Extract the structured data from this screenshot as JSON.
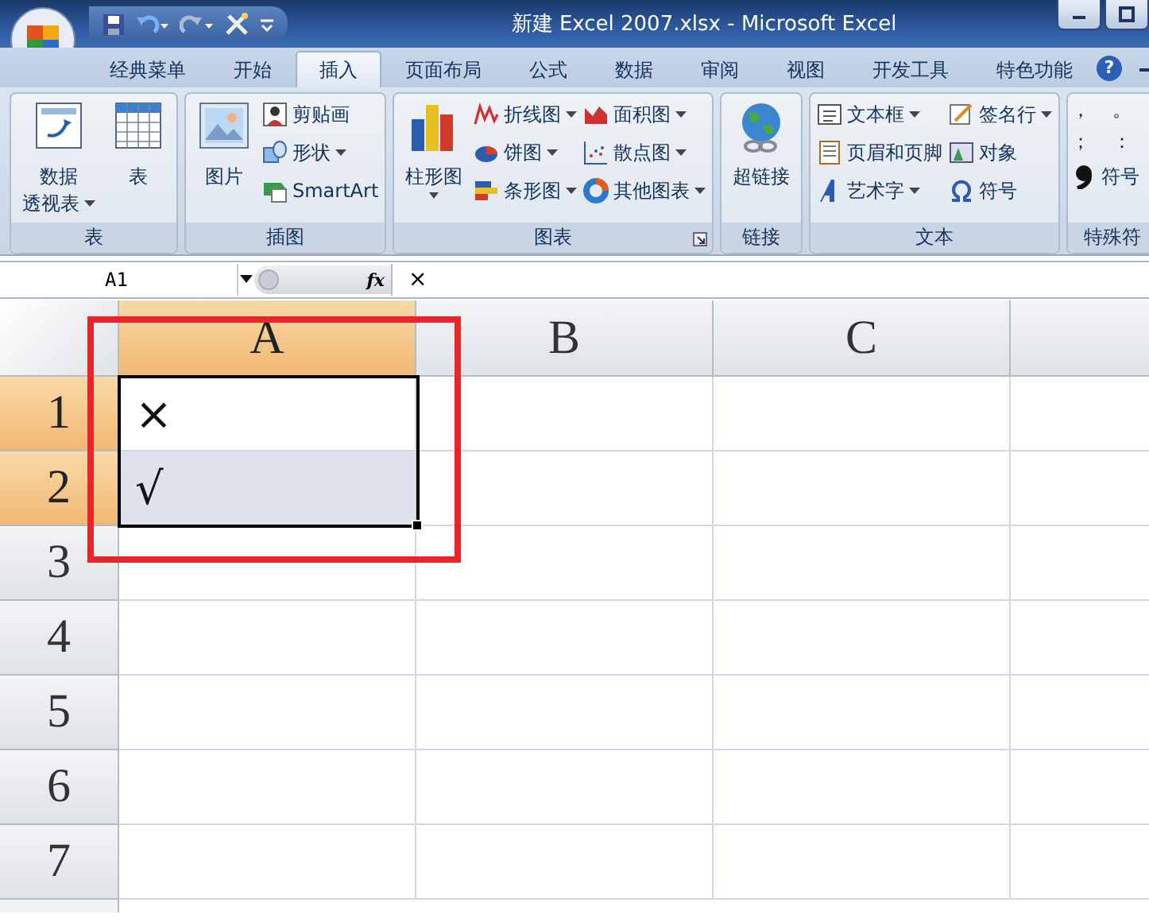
{
  "window": {
    "title": "新建 Excel 2007.xlsx - Microsoft Excel"
  },
  "tabs": [
    {
      "label": "经典菜单",
      "selected": false
    },
    {
      "label": "开始",
      "selected": false
    },
    {
      "label": "插入",
      "selected": true
    },
    {
      "label": "页面布局",
      "selected": false
    },
    {
      "label": "公式",
      "selected": false
    },
    {
      "label": "数据",
      "selected": false
    },
    {
      "label": "审阅",
      "selected": false
    },
    {
      "label": "视图",
      "selected": false
    },
    {
      "label": "开发工具",
      "selected": false
    },
    {
      "label": "特色功能",
      "selected": false
    }
  ],
  "help_button": "?",
  "ribbon_groups": [
    {
      "label": "表",
      "launcher": false,
      "items": [
        {
          "kind": "large",
          "lines": [
            "数据",
            "透视表"
          ],
          "dropdown": true
        },
        {
          "kind": "large",
          "lines": [
            "表"
          ],
          "dropdown": false
        }
      ]
    },
    {
      "label": "插图",
      "launcher": false,
      "items": [
        {
          "kind": "large",
          "lines": [
            "图片"
          ],
          "dropdown": false
        },
        {
          "kind": "stack",
          "items": [
            {
              "label": "剪贴画",
              "dropdown": false
            },
            {
              "label": "形状",
              "dropdown": true
            },
            {
              "label": "SmartArt",
              "dropdown": false
            }
          ]
        }
      ]
    },
    {
      "label": "图表",
      "launcher": true,
      "items": [
        {
          "kind": "large",
          "lines": [
            "柱形图"
          ],
          "dropdown": true
        },
        {
          "kind": "stack",
          "items": [
            {
              "label": "折线图",
              "dropdown": true
            },
            {
              "label": "饼图",
              "dropdown": true
            },
            {
              "label": "条形图",
              "dropdown": true
            }
          ]
        },
        {
          "kind": "stack",
          "items": [
            {
              "label": "面积图",
              "dropdown": true
            },
            {
              "label": "散点图",
              "dropdown": true
            },
            {
              "label": "其他图表",
              "dropdown": true
            }
          ]
        }
      ]
    },
    {
      "label": "链接",
      "launcher": false,
      "items": [
        {
          "kind": "large",
          "lines": [
            "超链接"
          ],
          "dropdown": false
        }
      ]
    },
    {
      "label": "文本",
      "launcher": false,
      "items": [
        {
          "kind": "stack",
          "items": [
            {
              "label": "文本框",
              "dropdown": true
            },
            {
              "label": "页眉和页脚",
              "dropdown": false
            },
            {
              "label": "艺术字",
              "dropdown": true
            }
          ]
        },
        {
          "kind": "stack",
          "items": [
            {
              "label": "签名行",
              "dropdown": true
            },
            {
              "label": "对象",
              "dropdown": false
            },
            {
              "label": "符号",
              "dropdown": false
            }
          ]
        }
      ]
    },
    {
      "label": "特殊符",
      "launcher": false,
      "items": [
        {
          "kind": "symbols",
          "symbols": [
            "，",
            "。",
            "；",
            "："
          ]
        },
        {
          "kind": "stack",
          "items": [
            {
              "label": "符号",
              "dropdown": false
            }
          ]
        }
      ]
    }
  ],
  "formula_bar": {
    "name_box": "A1",
    "fx": "fx",
    "value": "×"
  },
  "sheet": {
    "columns": [
      {
        "label": "A",
        "selected": true
      },
      {
        "label": "B",
        "selected": false
      },
      {
        "label": "C",
        "selected": false
      }
    ],
    "rows": [
      {
        "label": "1",
        "selected": true,
        "highlighted": true,
        "cells": [
          "×"
        ]
      },
      {
        "label": "2",
        "selected": true,
        "highlighted": true,
        "cells": [
          "√"
        ]
      },
      {
        "label": "3",
        "selected": false,
        "highlighted": false,
        "cells": []
      },
      {
        "label": "4",
        "selected": false,
        "highlighted": false,
        "cells": []
      },
      {
        "label": "5",
        "selected": false,
        "highlighted": false,
        "cells": []
      },
      {
        "label": "6",
        "selected": false,
        "highlighted": false,
        "cells": []
      },
      {
        "label": "7",
        "selected": false,
        "highlighted": false,
        "cells": []
      }
    ]
  }
}
